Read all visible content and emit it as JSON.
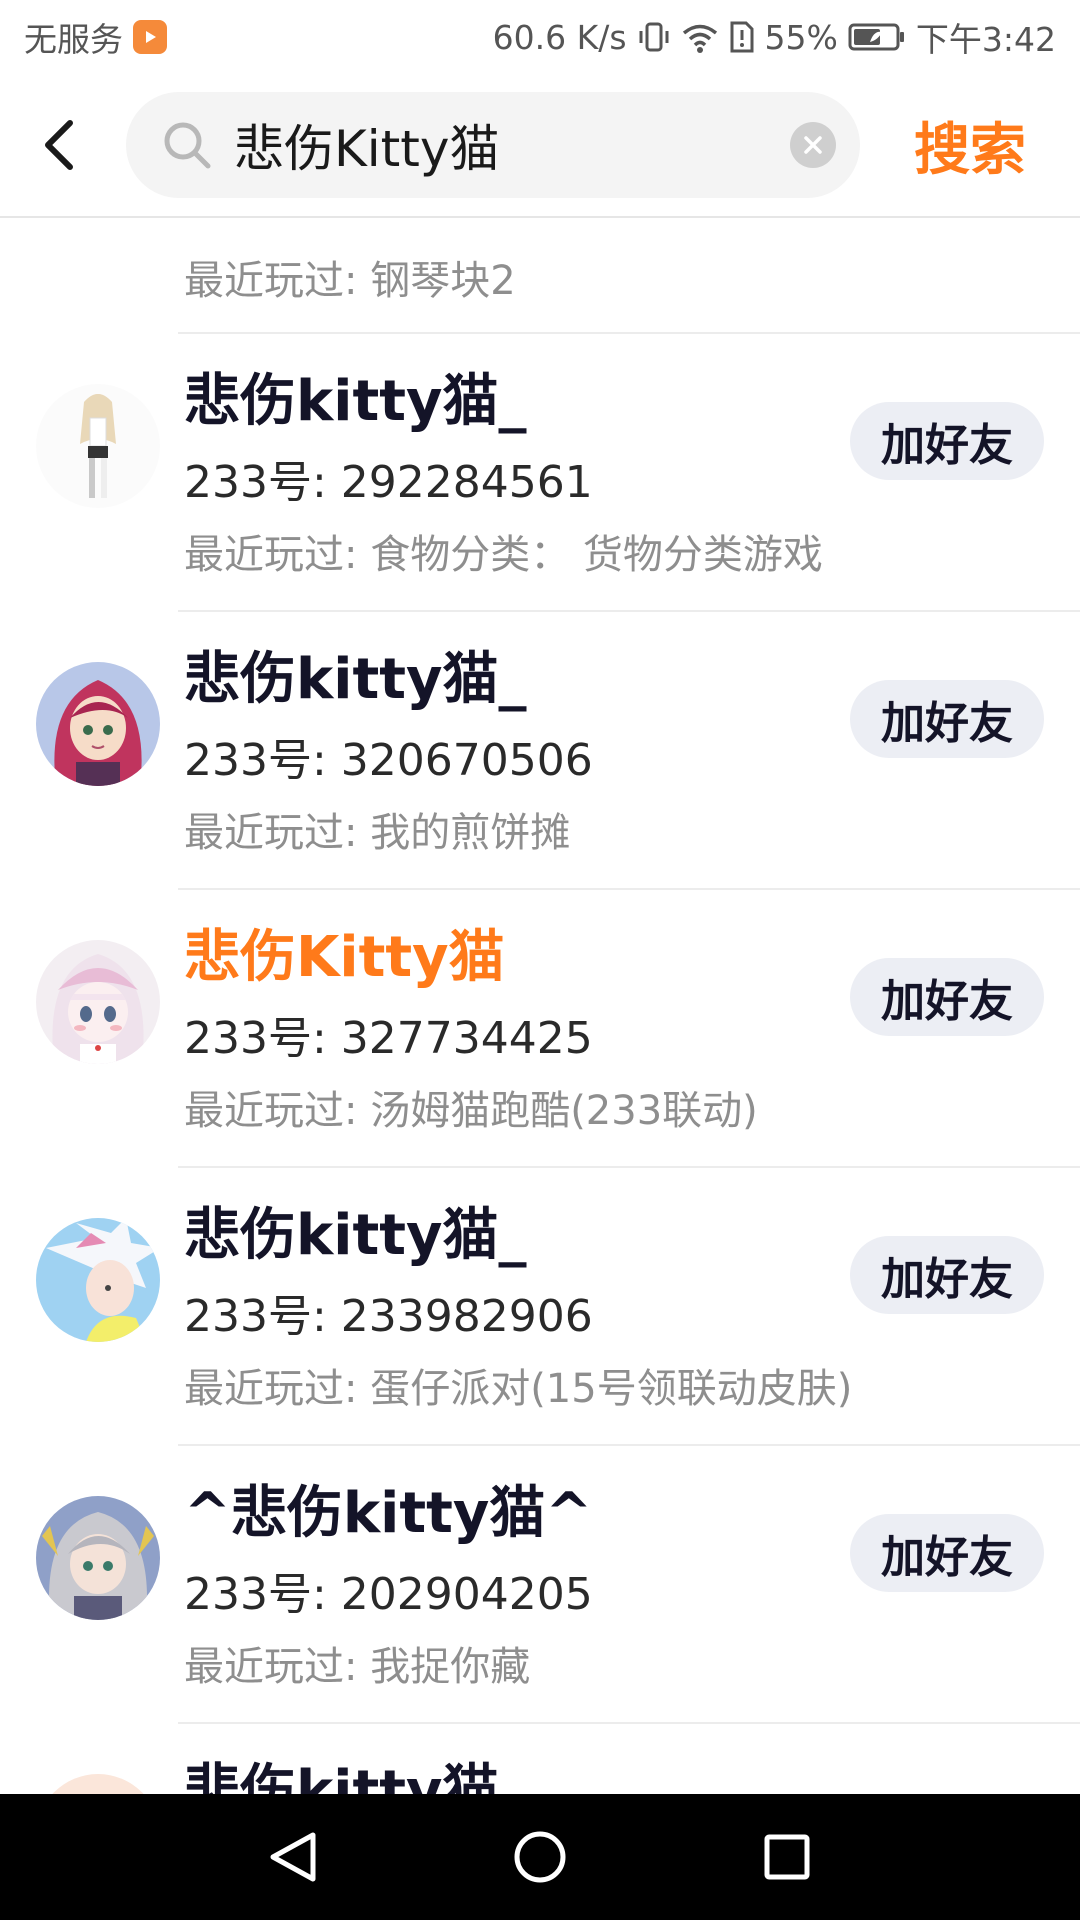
{
  "status_bar": {
    "carrier": "无服务",
    "net_speed": "60.6 K/s",
    "battery": "55%",
    "time": "下午3:42"
  },
  "search": {
    "query": "悲伤Kitty猫",
    "submit_label": "搜索"
  },
  "partial_top": {
    "recent": "最近玩过: 钢琴块2"
  },
  "results": [
    {
      "name": "悲伤kitty猫_",
      "id_line": "233号: 292284561",
      "recent": "最近玩过: 食物分类： 货物分类游戏",
      "button": "加好友",
      "avatar": "girl-figure-avatar",
      "highlight": false
    },
    {
      "name": "悲伤kitty猫_",
      "id_line": "233号: 320670506",
      "recent": "最近玩过: 我的煎饼摊",
      "button": "加好友",
      "avatar": "pink-hair-girl-avatar",
      "highlight": false
    },
    {
      "name": "悲伤Kitty猫",
      "id_line": "233号: 327734425",
      "recent": "最近玩过: 汤姆猫跑酷(233联动)",
      "button": "加好友",
      "avatar": "white-hair-girl-avatar",
      "highlight": true
    },
    {
      "name": "悲伤kitty猫_",
      "id_line": "233号: 233982906",
      "recent": "最近玩过: 蛋仔派对(15号领联动皮肤)",
      "button": "加好友",
      "avatar": "blue-sky-avatar",
      "highlight": false
    },
    {
      "name": "^悲伤kitty猫^",
      "id_line": "233号: 202904205",
      "recent": "最近玩过: 我捉你藏",
      "button": "加好友",
      "avatar": "silver-hair-avatar",
      "highlight": false
    },
    {
      "name": "悲伤kitty猫",
      "id_line": "",
      "recent": "",
      "button": "",
      "avatar": "cream-avatar",
      "highlight": false
    }
  ]
}
